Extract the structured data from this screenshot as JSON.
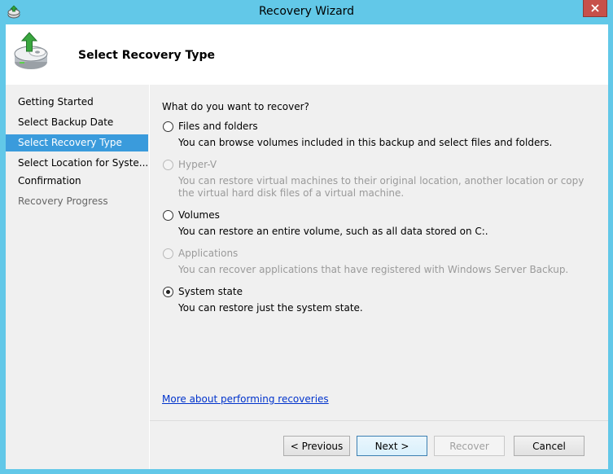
{
  "window": {
    "title": "Recovery Wizard"
  },
  "header": {
    "title": "Select Recovery Type",
    "icon": "backup-restore-icon"
  },
  "steps": [
    {
      "label": "Getting Started",
      "state": "normal"
    },
    {
      "label": "Select Backup Date",
      "state": "normal"
    },
    {
      "label": "Select Recovery Type",
      "state": "active"
    },
    {
      "label": "Select Location for Syste...",
      "state": "dim"
    },
    {
      "label": "Confirmation",
      "state": "normal"
    },
    {
      "label": "Recovery Progress",
      "state": "dim"
    }
  ],
  "main": {
    "question": "What do you want to recover?",
    "options": [
      {
        "label": "Files and folders",
        "description": "You can browse volumes included in this backup and select files and folders.",
        "enabled": true,
        "selected": false
      },
      {
        "label": "Hyper-V",
        "description": "You can restore virtual machines to their original location, another location or copy the virtual hard disk files of a virtual machine.",
        "enabled": false,
        "selected": false
      },
      {
        "label": "Volumes",
        "description": "You can restore an entire volume, such as all data stored on C:.",
        "enabled": true,
        "selected": false
      },
      {
        "label": "Applications",
        "description": "You can recover applications that have registered with Windows Server Backup.",
        "enabled": false,
        "selected": false
      },
      {
        "label": "System state",
        "description": "You can restore just the system state.",
        "enabled": true,
        "selected": true
      }
    ],
    "link": "More about performing recoveries"
  },
  "buttons": {
    "previous": "< Previous",
    "next": "Next >",
    "recover": "Recover",
    "cancel": "Cancel"
  },
  "colors": {
    "frame": "#62c8e8",
    "selection": "#3a9bdc",
    "link": "#0033cc",
    "close": "#c7504a"
  }
}
